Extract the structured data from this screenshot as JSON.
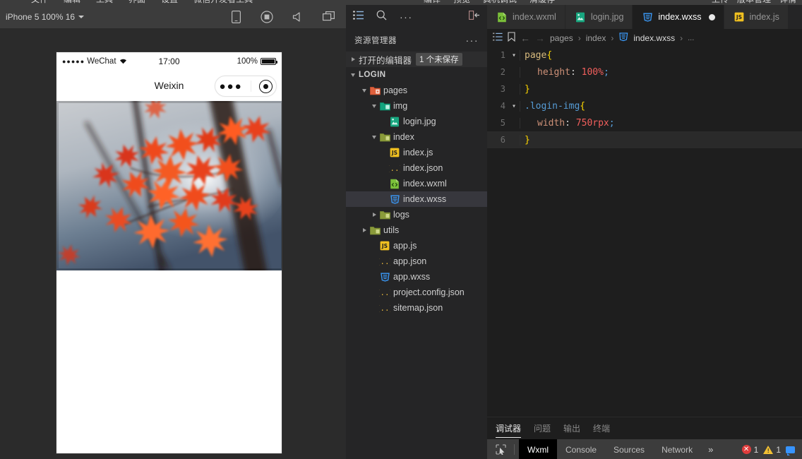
{
  "window": {
    "menu_items": [
      "文件",
      "编辑",
      "工具",
      "界面",
      "设置",
      "微信开发者工具"
    ],
    "menu_center": [
      "编译",
      "预览",
      "真机调试",
      "清缓存"
    ],
    "menu_right": [
      "上传",
      "版本管理",
      "详情"
    ]
  },
  "simulator": {
    "device_label": "iPhone 5 100% 16",
    "icons": [
      "phone-icon",
      "record-icon",
      "speaker-icon",
      "windows-icon"
    ],
    "phone": {
      "status": {
        "carrier": "WeChat",
        "signal_dots": "●●●●●",
        "time": "17:00",
        "battery_percent": "100%"
      },
      "nav_title": "Weixin",
      "capsule": {
        "dots": "●●●",
        "target": "target-icon"
      },
      "preview_alt": "red maple leaves photo"
    }
  },
  "explorer": {
    "actions": [
      "explorer-icon",
      "search-icon",
      "more-icon",
      "collapse-icon"
    ],
    "title": "资源管理器",
    "title_more": "···",
    "open_editors": {
      "label": "打开的编辑器",
      "badge": "1 个未保存"
    },
    "root": "LOGIN",
    "tree": [
      {
        "label": "pages",
        "indent": 1,
        "type": "folder-open",
        "arrow": "down",
        "icon": "folder-pages-icon"
      },
      {
        "label": "img",
        "indent": 2,
        "type": "folder-open",
        "arrow": "down",
        "icon": "folder-img-icon"
      },
      {
        "label": "login.jpg",
        "indent": 3,
        "type": "image",
        "arrow": "none",
        "icon": "image-file-icon"
      },
      {
        "label": "index",
        "indent": 2,
        "type": "folder-open",
        "arrow": "down",
        "icon": "folder-icon"
      },
      {
        "label": "index.js",
        "indent": 3,
        "type": "js",
        "arrow": "none",
        "icon": "js-file-icon"
      },
      {
        "label": "index.json",
        "indent": 3,
        "type": "json",
        "arrow": "none",
        "icon": "json-file-icon"
      },
      {
        "label": "index.wxml",
        "indent": 3,
        "type": "wxml",
        "arrow": "none",
        "icon": "wxml-file-icon"
      },
      {
        "label": "index.wxss",
        "indent": 3,
        "type": "wxss",
        "arrow": "none",
        "icon": "wxss-file-icon",
        "selected": true
      },
      {
        "label": "logs",
        "indent": 2,
        "type": "folder",
        "arrow": "right",
        "icon": "folder-logs-icon"
      },
      {
        "label": "utils",
        "indent": 1,
        "type": "folder",
        "arrow": "right",
        "icon": "folder-utils-icon"
      },
      {
        "label": "app.js",
        "indent": 2,
        "type": "js",
        "arrow": "none",
        "icon": "js-file-icon"
      },
      {
        "label": "app.json",
        "indent": 2,
        "type": "json",
        "arrow": "none",
        "icon": "json-file-icon"
      },
      {
        "label": "app.wxss",
        "indent": 2,
        "type": "wxss",
        "arrow": "none",
        "icon": "wxss-file-icon"
      },
      {
        "label": "project.config.json",
        "indent": 2,
        "type": "json",
        "arrow": "none",
        "icon": "json-file-icon"
      },
      {
        "label": "sitemap.json",
        "indent": 2,
        "type": "json",
        "arrow": "none",
        "icon": "json-file-icon"
      }
    ]
  },
  "editor": {
    "tabs": [
      {
        "label": "index.wxml",
        "icon": "wxml-file-icon",
        "active": false,
        "dirty": false
      },
      {
        "label": "login.jpg",
        "icon": "image-file-icon",
        "active": false,
        "dirty": false
      },
      {
        "label": "index.wxss",
        "icon": "wxss-file-icon",
        "active": true,
        "dirty": true
      },
      {
        "label": "index.js",
        "icon": "js-file-icon",
        "active": false,
        "dirty": false
      }
    ],
    "breadcrumb": {
      "crumbs": [
        "pages",
        "index",
        "index.wxss",
        "..."
      ],
      "file_icon": "wxss-file-icon"
    },
    "lines": [
      {
        "n": "1",
        "fold": "v",
        "indent": 0,
        "tokens": [
          {
            "t": "page",
            "c": "k-sel"
          },
          {
            "t": "{",
            "c": "k-brace"
          }
        ]
      },
      {
        "n": "2",
        "fold": "",
        "indent": 1,
        "tokens": [
          {
            "t": "height",
            "c": "k-prop"
          },
          {
            "t": ": ",
            "c": "k-punc"
          },
          {
            "t": "100%",
            "c": "k-val"
          },
          {
            "t": ";",
            "c": "k-semi"
          }
        ]
      },
      {
        "n": "3",
        "fold": "",
        "indent": 0,
        "tokens": [
          {
            "t": "}",
            "c": "k-brace"
          }
        ]
      },
      {
        "n": "4",
        "fold": "v",
        "indent": 0,
        "tokens": [
          {
            "t": ".",
            "c": "k-dot"
          },
          {
            "t": "login-img",
            "c": "k-dot"
          },
          {
            "t": "{",
            "c": "k-brace"
          }
        ]
      },
      {
        "n": "5",
        "fold": "",
        "indent": 1,
        "tokens": [
          {
            "t": "width",
            "c": "k-prop"
          },
          {
            "t": ": ",
            "c": "k-punc"
          },
          {
            "t": "750rpx",
            "c": "k-val"
          },
          {
            "t": ";",
            "c": "k-semi"
          }
        ]
      },
      {
        "n": "6",
        "fold": "",
        "indent": 0,
        "current": true,
        "tokens": [
          {
            "t": "}",
            "c": "k-brace"
          }
        ]
      }
    ]
  },
  "panel": {
    "tabs": [
      {
        "label": "调试器",
        "active": true
      },
      {
        "label": "问题",
        "active": false
      },
      {
        "label": "输出",
        "active": false
      },
      {
        "label": "终端",
        "active": false
      }
    ],
    "devtools": {
      "picker_icon": "element-picker-icon",
      "tabs": [
        {
          "label": "Wxml",
          "active": true
        },
        {
          "label": "Console",
          "active": false
        },
        {
          "label": "Sources",
          "active": false
        },
        {
          "label": "Network",
          "active": false
        }
      ],
      "more": "»",
      "error_count": "1",
      "warning_count": "1",
      "message_icon": "message-icon"
    }
  },
  "colors": {
    "accent": "#3794ff",
    "error": "#e03c3c",
    "warning": "#f2c033",
    "editor_bg": "#1e1e1e",
    "sidebar_bg": "#252526",
    "selection": "#37373d"
  }
}
